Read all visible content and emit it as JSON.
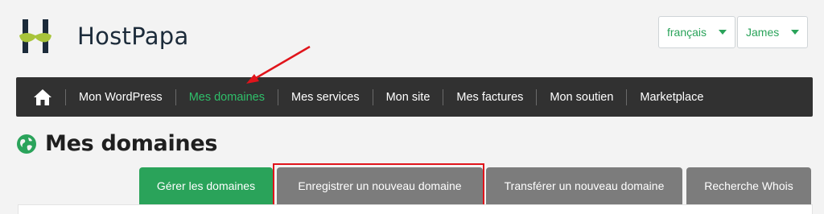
{
  "brand": {
    "name": "HostPapa"
  },
  "header": {
    "language": "français",
    "user": "James"
  },
  "nav": {
    "items": [
      {
        "label": "Mon WordPress"
      },
      {
        "label": "Mes domaines"
      },
      {
        "label": "Mes services"
      },
      {
        "label": "Mon site"
      },
      {
        "label": "Mes factures"
      },
      {
        "label": "Mon soutien"
      },
      {
        "label": "Marketplace"
      }
    ],
    "active_index": 1
  },
  "page": {
    "title": "Mes domaines"
  },
  "tabs": [
    {
      "label": "Gérer les domaines"
    },
    {
      "label": "Enregistrer un nouveau domaine"
    },
    {
      "label": "Transférer un nouveau domaine"
    },
    {
      "label": "Recherche Whois"
    }
  ],
  "colors": {
    "accent_green": "#2aa35a",
    "nav_bg": "#313131",
    "annotation_red": "#e0141b"
  }
}
